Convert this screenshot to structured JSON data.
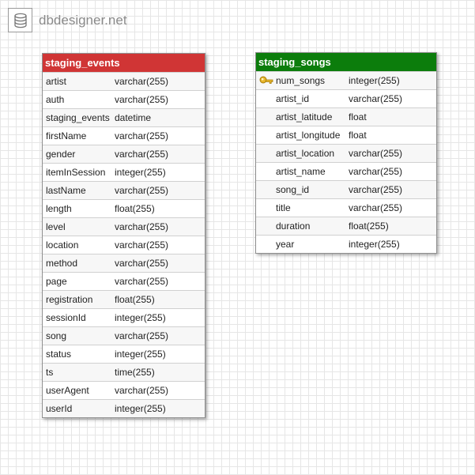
{
  "brand": {
    "name": "dbdesigner.net",
    "icon": "database-icon"
  },
  "tables": [
    {
      "id": "staging_events",
      "name": "staging_events",
      "header_color": "#d03535",
      "columns": [
        {
          "name": "artist",
          "type": "varchar(255)"
        },
        {
          "name": "auth",
          "type": "varchar(255)"
        },
        {
          "name": "staging_events",
          "type": "datetime"
        },
        {
          "name": "firstName",
          "type": "varchar(255)"
        },
        {
          "name": "gender",
          "type": "varchar(255)"
        },
        {
          "name": "itemInSession",
          "type": "integer(255)"
        },
        {
          "name": "lastName",
          "type": "varchar(255)"
        },
        {
          "name": "length",
          "type": "float(255)"
        },
        {
          "name": "level",
          "type": "varchar(255)"
        },
        {
          "name": "location",
          "type": "varchar(255)"
        },
        {
          "name": "method",
          "type": "varchar(255)"
        },
        {
          "name": "page",
          "type": "varchar(255)"
        },
        {
          "name": "registration",
          "type": "float(255)"
        },
        {
          "name": "sessionId",
          "type": "integer(255)"
        },
        {
          "name": "song",
          "type": "varchar(255)"
        },
        {
          "name": "status",
          "type": "integer(255)"
        },
        {
          "name": "ts",
          "type": "time(255)"
        },
        {
          "name": "userAgent",
          "type": "varchar(255)"
        },
        {
          "name": "userId",
          "type": "integer(255)"
        }
      ]
    },
    {
      "id": "staging_songs",
      "name": "staging_songs",
      "header_color": "#0c7d0c",
      "columns": [
        {
          "name": "num_songs",
          "type": "integer(255)",
          "primary_key": true
        },
        {
          "name": "artist_id",
          "type": "varchar(255)"
        },
        {
          "name": "artist_latitude",
          "type": "float"
        },
        {
          "name": "artist_longitude",
          "type": "float"
        },
        {
          "name": "artist_location",
          "type": "varchar(255)"
        },
        {
          "name": "artist_name",
          "type": "varchar(255)"
        },
        {
          "name": "song_id",
          "type": "varchar(255)"
        },
        {
          "name": "title",
          "type": "varchar(255)"
        },
        {
          "name": "duration",
          "type": "float(255)"
        },
        {
          "name": "year",
          "type": "integer(255)"
        }
      ]
    }
  ]
}
